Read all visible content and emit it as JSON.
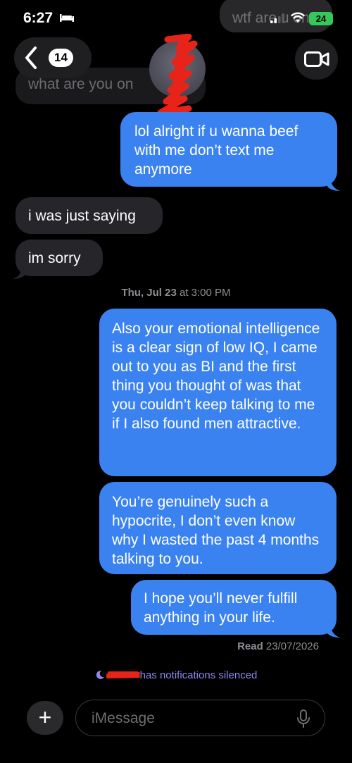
{
  "status_bar": {
    "time": "6:27",
    "battery": "24"
  },
  "header": {
    "back_count": "14"
  },
  "messages": [
    {
      "side": "out",
      "text": "wtf are u on"
    },
    {
      "side": "in",
      "text": "what are you on"
    },
    {
      "side": "out",
      "text": "lol alright if u wanna beef with me don’t text me anymore"
    },
    {
      "side": "in",
      "text": "i was just saying"
    },
    {
      "side": "in",
      "text": "im sorry"
    },
    {
      "side": "out",
      "text": "Also your emotional intelligence is a clear sign of low IQ, I came out to you as BI and the first thing you thought of was that you couldn’t keep talking to me if I also found men attractive."
    },
    {
      "side": "out",
      "text": "You’re genuinely such a hypocrite, I don’t even know why I wasted the past 4 months talking to you."
    },
    {
      "side": "out",
      "text": "I hope you’ll never fulfill anything in your life."
    }
  ],
  "timestamp": {
    "day": "Thu, Jul 23",
    "at": "at 3:00 PM"
  },
  "read_receipt": {
    "label": "Read",
    "date": "23/07/2026"
  },
  "focus_notice": {
    "text": "has notifications silenced"
  },
  "composer": {
    "placeholder": "iMessage",
    "plus": "+"
  },
  "colors": {
    "outgoing": "#3b82f1",
    "incoming": "#26252a",
    "focus": "#8f86f0"
  }
}
